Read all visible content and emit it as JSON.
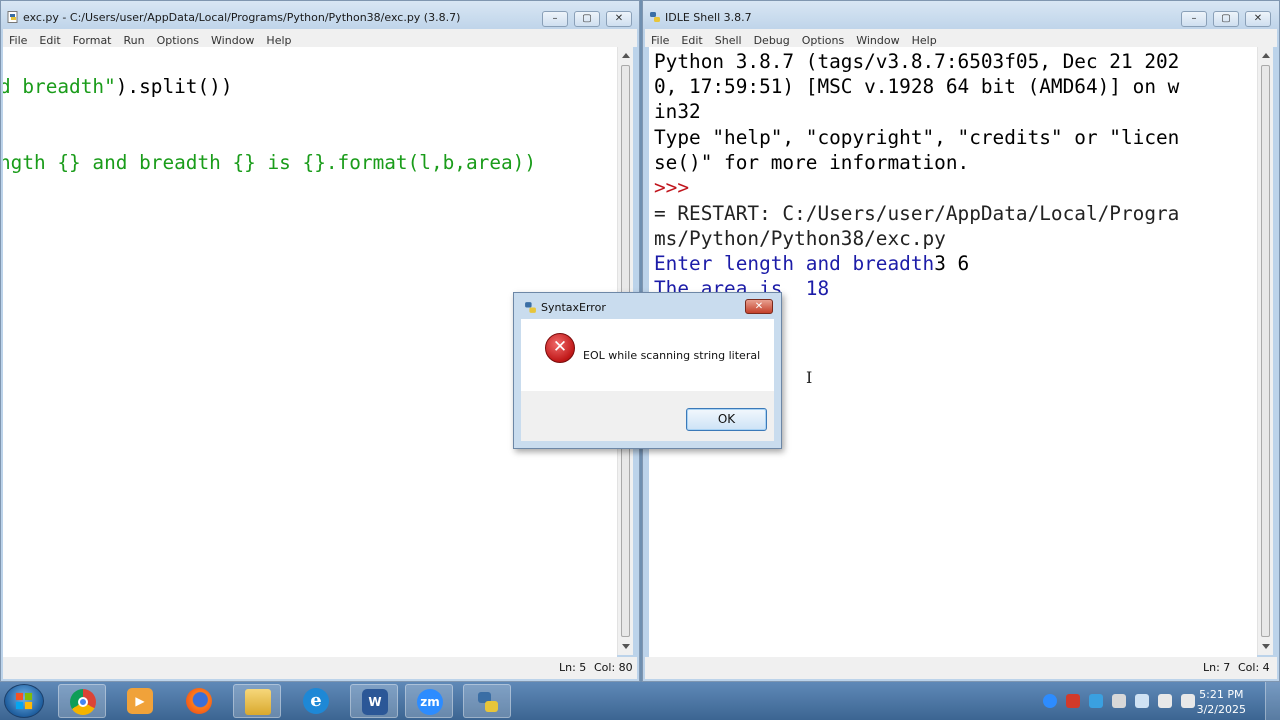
{
  "editor": {
    "title": "exc.py - C:/Users/user/AppData/Local/Programs/Python/Python38/exc.py (3.8.7)",
    "menu": [
      "File",
      "Edit",
      "Format",
      "Run",
      "Options",
      "Window",
      "Help"
    ],
    "line1_a": "d breadth\"",
    "line1_b": ").split())",
    "line2": "ngth {} and breadth {} is {}.format(l,b,area))",
    "status_line": "Ln: 5",
    "status_col": "Col: 80"
  },
  "shell": {
    "title": "IDLE Shell 3.8.7",
    "menu": [
      "File",
      "Edit",
      "Shell",
      "Debug",
      "Options",
      "Window",
      "Help"
    ],
    "lines": [
      "Python 3.8.7 (tags/v3.8.7:6503f05, Dec 21 202",
      "0, 17:59:51) [MSC v.1928 64 bit (AMD64)] on w",
      "in32",
      "Type \"help\", \"copyright\", \"credits\" or \"licen",
      "se()\" for more information.",
      ">>>",
      "= RESTART: C:/Users/user/AppData/Local/Progra",
      "ms/Python/Python38/exc.py",
      "Enter length and breadth",
      "3 6",
      "The area is  18"
    ],
    "status_line": "Ln: 7",
    "status_col": "Col: 4"
  },
  "dialog": {
    "title": "SyntaxError",
    "message": "EOL while scanning string literal",
    "ok_label": "OK",
    "close_label": "✕",
    "error_glyph": "✕"
  },
  "window_controls": {
    "minimize": "–",
    "maximize": "▢",
    "close": "✕"
  },
  "taskbar": {
    "apps": [
      {
        "name": "chrome-icon",
        "glyph": ""
      },
      {
        "name": "media-player-icon",
        "glyph": "▶"
      },
      {
        "name": "firefox-icon",
        "glyph": ""
      },
      {
        "name": "file-explorer-icon",
        "glyph": ""
      },
      {
        "name": "internet-explorer-icon",
        "glyph": "e"
      },
      {
        "name": "word-icon",
        "glyph": "W"
      },
      {
        "name": "zoom-icon",
        "glyph": "zm"
      },
      {
        "name": "python-icon",
        "glyph": ""
      }
    ],
    "time": "5:21 PM",
    "date": "3/2/2025"
  },
  "colors": {
    "string_green": "#1a9c1a",
    "output_blue": "#1c1ca8",
    "error_red": "#c0141c"
  }
}
